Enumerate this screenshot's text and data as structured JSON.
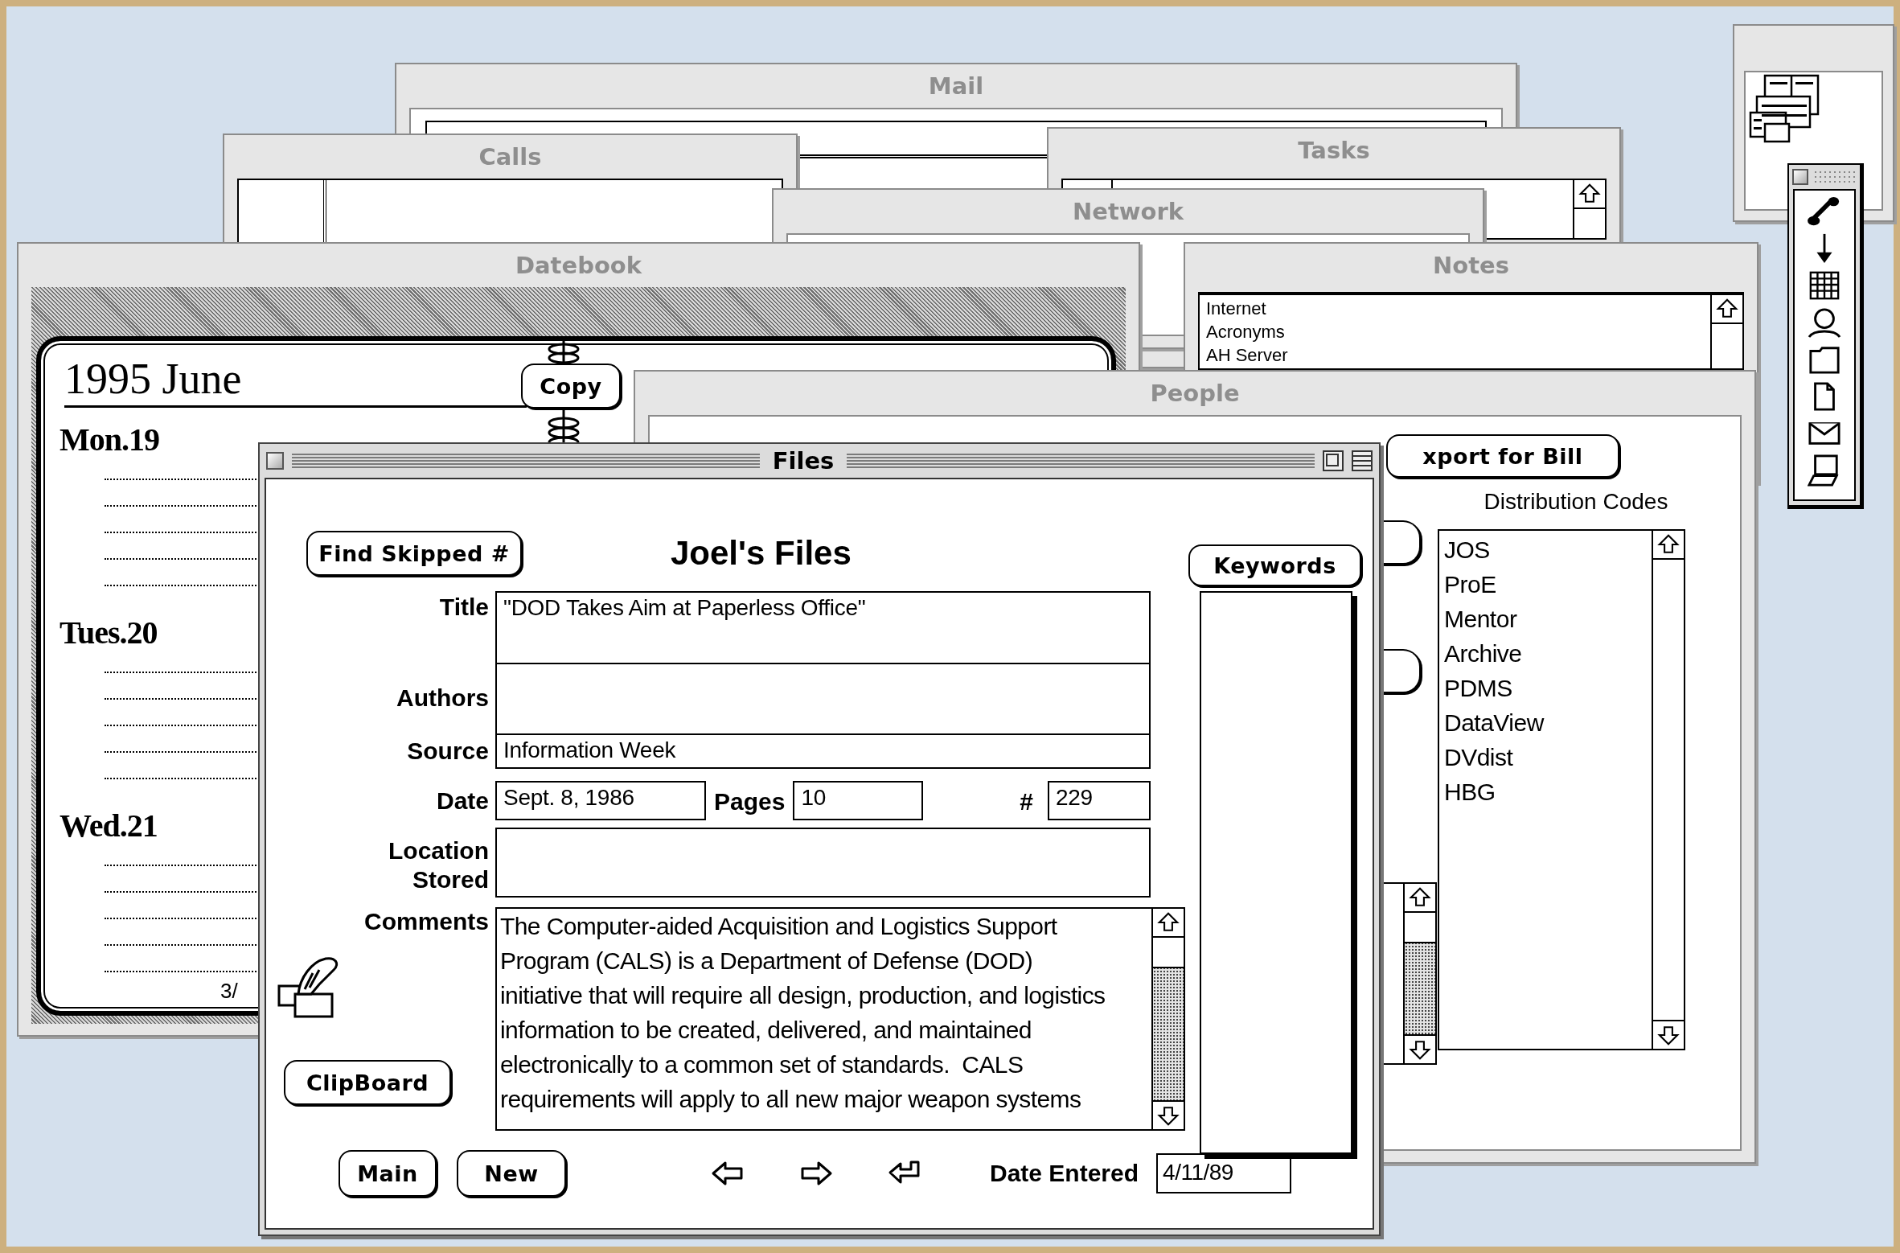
{
  "mail": {
    "title": "Mail"
  },
  "calls": {
    "title": "Calls"
  },
  "tasks": {
    "title": "Tasks"
  },
  "network": {
    "title": "Network"
  },
  "datebook": {
    "title": "Datebook",
    "month": "1995 June",
    "copy_button": "Copy",
    "days": [
      "Mon.19",
      "Tues.20",
      "Wed.21"
    ],
    "page_number": "3/"
  },
  "notes": {
    "title": "Notes",
    "items": [
      "Internet",
      "Acronyms",
      "AH Server"
    ]
  },
  "people": {
    "title": "People",
    "export_button": "xport for Bill",
    "codes_label": "Distribution Codes",
    "codes": [
      "JOS",
      "ProE",
      "Mentor",
      "Archive",
      "PDMS",
      "DataView",
      "DVdist",
      "HBG"
    ]
  },
  "files": {
    "title": "Files",
    "heading": "Joel's Files",
    "find_button": "Find Skipped #",
    "keywords_button": "Keywords",
    "title_field": {
      "label": "Title",
      "value": "\"DOD Takes Aim at Paperless Office\""
    },
    "authors_field": {
      "label": "Authors"
    },
    "source_field": {
      "label": "Source",
      "value": "Information Week"
    },
    "date_field": {
      "label": "Date",
      "value": "Sept. 8, 1986"
    },
    "pages_field": {
      "label": "Pages",
      "value": "10"
    },
    "number_field": {
      "label": "#",
      "value": "229"
    },
    "location_field": {
      "label": "Location Stored"
    },
    "comments_field": {
      "label": "Comments",
      "lines": [
        "The Computer-aided Acquisition and Logistics Support",
        "Program (CALS) is a Department of Defense (DOD)",
        "initiative that will require all design, production, and logistics",
        "information to be created, delivered, and maintained",
        "electronically to a common set of standards.  CALS",
        "requirements will apply to all new major weapon systems"
      ]
    },
    "clipboard_button": "ClipBoard",
    "main_button": "Main",
    "new_button": "New",
    "date_entered": {
      "label": "Date Entered",
      "value": "4/11/89"
    }
  }
}
